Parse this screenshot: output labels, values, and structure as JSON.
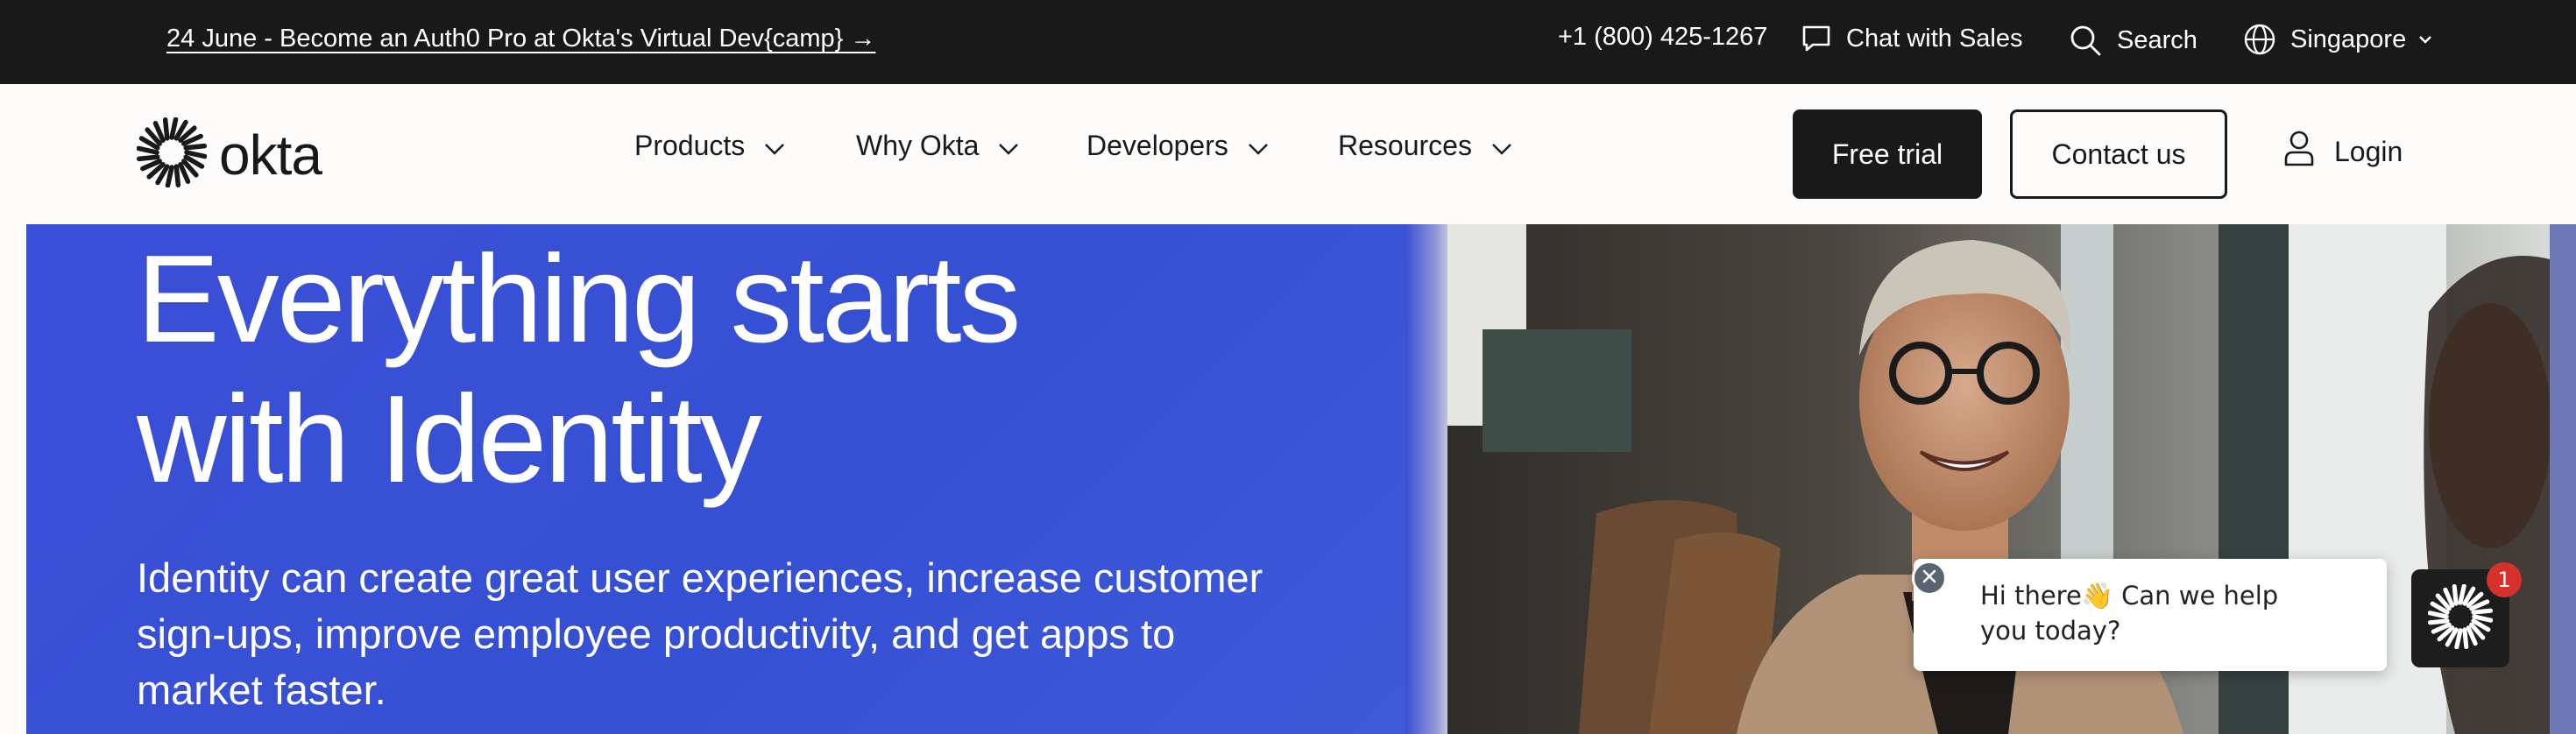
{
  "topbar": {
    "promo_text": "24 June - Become an Auth0 Pro at Okta's Virtual Dev{camp} →",
    "phone": "+1 (800) 425-1267",
    "chat_label": "Chat with Sales",
    "search_label": "Search",
    "region_label": "Singapore",
    "icons": [
      "chat-icon",
      "search-icon",
      "globe-icon",
      "chevron-down-icon"
    ]
  },
  "nav": {
    "logo_text": "okta",
    "menu": [
      {
        "label": "Products"
      },
      {
        "label": "Why Okta"
      },
      {
        "label": "Developers"
      },
      {
        "label": "Resources"
      }
    ],
    "free_trial_label": "Free trial",
    "contact_label": "Contact us",
    "login_label": "Login"
  },
  "hero": {
    "title_line1": "Everything starts",
    "title_line2": "with Identity",
    "subtitle": "Identity can create great user experiences, increase customer sign-ups, improve employee productivity, and get apps to market faster."
  },
  "chat_widget": {
    "message": "Hi there👋 Can we help you today?",
    "badge_count": "1"
  },
  "colors": {
    "topbar_bg": "#191919",
    "hero_blue": "#3b4fd6",
    "page_bg": "#fdfcfa",
    "badge_red": "#d6322b"
  }
}
